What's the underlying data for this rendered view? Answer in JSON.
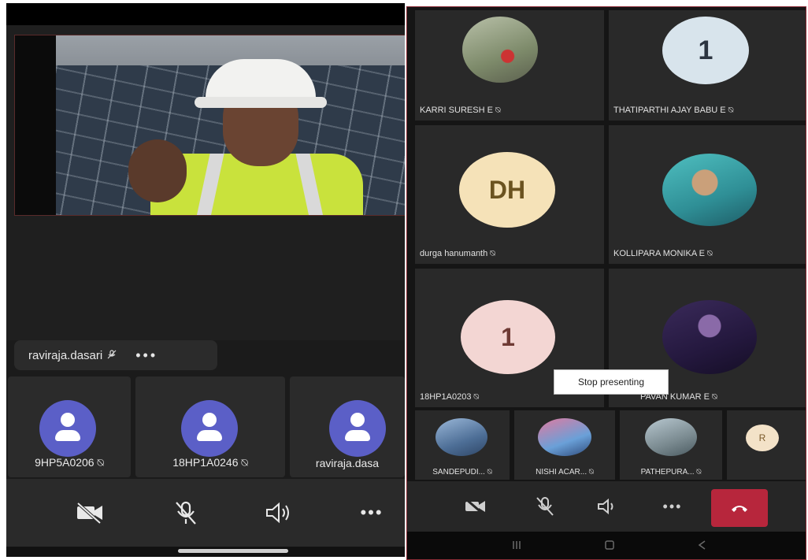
{
  "left": {
    "presenter": {
      "name": "raviraja.dasari",
      "more": "•••"
    },
    "participants": [
      {
        "label": "9HP5A0206"
      },
      {
        "label": "18HP1A0246"
      },
      {
        "label": "raviraja.dasa"
      }
    ],
    "toolbar": {
      "camera": "camera-off-icon",
      "mic": "mic-off-icon",
      "speaker": "speaker-icon",
      "more": "•••"
    }
  },
  "right": {
    "grid": [
      {
        "name": "KARRI SURESH E"
      },
      {
        "name": "THATIPARTHI AJAY BABU E",
        "initials": "1",
        "color": "#d8e4ec",
        "text_color": "#2b3440"
      },
      {
        "name": "durga hanumanth",
        "initials": "DH",
        "color": "#f5e2b8",
        "text_color": "#6b5320"
      },
      {
        "name": "KOLLIPARA MONIKA E"
      },
      {
        "name": "18HP1A0203",
        "initials": "1",
        "color": "#f3d6d3",
        "text_color": "#6e3a34"
      },
      {
        "name": "PAVAN KUMAR E"
      }
    ],
    "tooltip": "Stop presenting",
    "strip": [
      {
        "name": "SANDEPUDI..."
      },
      {
        "name": "NISHI ACAR..."
      },
      {
        "name": "PATHEPURA..."
      },
      {
        "name": "R",
        "initials": "R",
        "color": "#f3e2c8",
        "text_color": "#7a5a2a"
      }
    ],
    "toolbar": {
      "more": "•••"
    }
  }
}
